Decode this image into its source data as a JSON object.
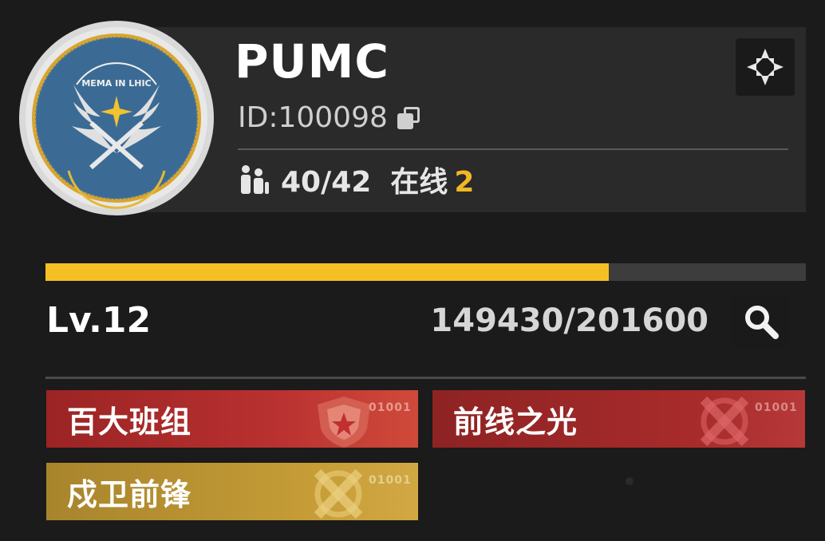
{
  "clan": {
    "name": "PUMC",
    "id_label": "ID:",
    "id_value": "100098",
    "members_count": "40/42",
    "online_label": "在线",
    "online_count": "2",
    "emblem_text": "MEMA IN LHIC"
  },
  "level": {
    "label": "Lv.12",
    "xp_text": "149430/201600",
    "xp_current": 149430,
    "xp_max": 201600
  },
  "tags": [
    {
      "label": "百大班组",
      "code": "01001",
      "icon": "shield-star-icon",
      "color": "#b83030"
    },
    {
      "label": "前线之光",
      "code": "01001",
      "icon": "crossed-swords-icon",
      "color": "#a82b2b"
    },
    {
      "label": "戍卫前锋",
      "code": "01001",
      "icon": "crossed-swords-icon",
      "color": "#c59c36"
    }
  ],
  "icons": {
    "corner": "target-crosshair-icon",
    "search": "search-icon",
    "copy": "copy-icon",
    "members": "members-icon"
  },
  "colors": {
    "accent": "#f5c024",
    "online": "#f0b824",
    "emblem_blue": "#3b6b95",
    "emblem_ring": "#e5b838"
  }
}
